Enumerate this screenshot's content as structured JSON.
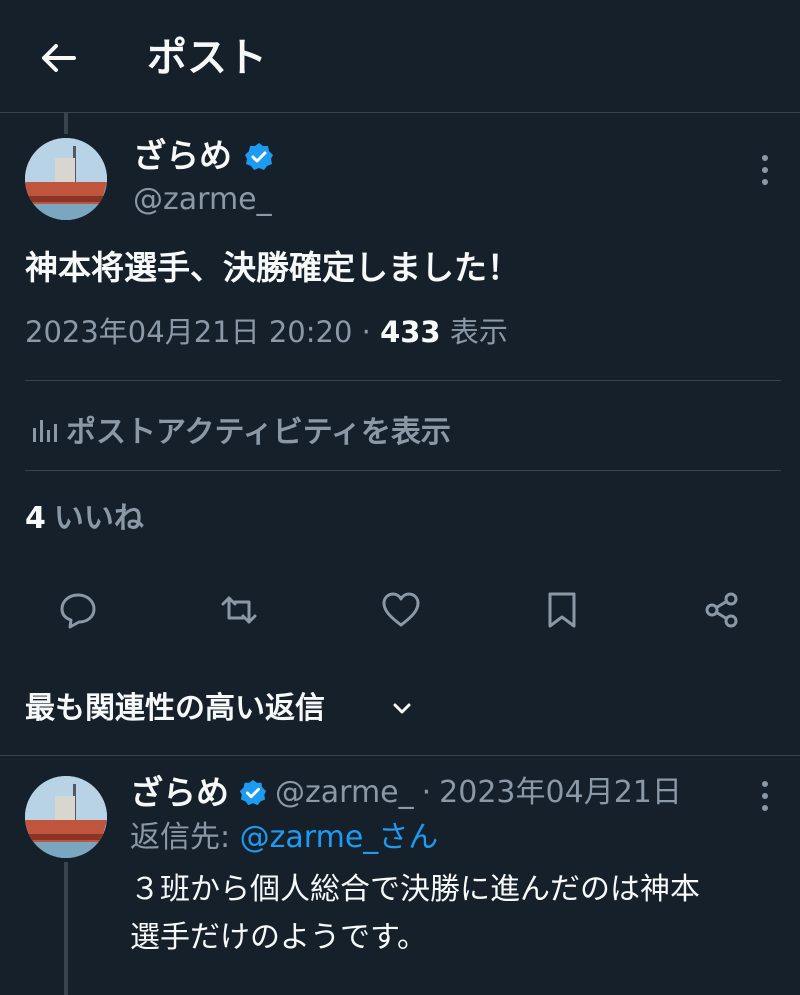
{
  "header": {
    "title": "ポスト"
  },
  "post": {
    "author_name": "ざらめ",
    "author_handle": "@zarme_",
    "text": "神本将選手、決勝確定しました！",
    "timestamp": "2023年04月21日 20:20",
    "separator": "·",
    "views_count": "433",
    "views_label": "表示",
    "activity_label": "ポストアクティビティを表示",
    "likes_count": "4",
    "likes_label": "いいね"
  },
  "actions": [
    "reply-icon",
    "retweet-icon",
    "like-icon",
    "bookmark-icon",
    "share-icon"
  ],
  "replies_sort": {
    "label": "最も関連性の高い返信"
  },
  "reply": {
    "author_name": "ざらめ",
    "author_handle": "@zarme_",
    "separator": "·",
    "date": "2023年04月21日",
    "replying_to_label": "返信先:",
    "replying_to_handle": "@zarme_",
    "replying_to_suffix": "さん",
    "text_line1": "３班から個人総合で決勝に進んだのは神本",
    "text_line2": "選手だけのようです。"
  },
  "colors": {
    "background": "#15202b",
    "text": "#f7f9f9",
    "secondary": "#8b98a5",
    "accent": "#1d9bf0",
    "divider": "#38444d"
  }
}
